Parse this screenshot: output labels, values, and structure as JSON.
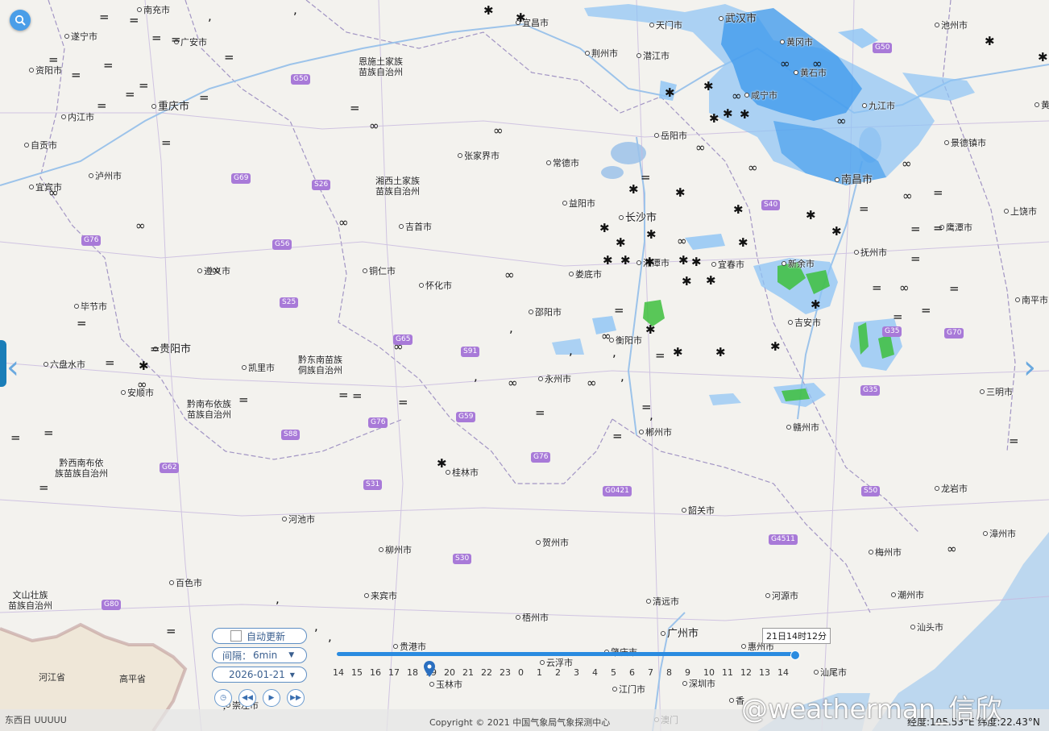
{
  "cities": [
    {
      "name": "南充市",
      "big": false
    },
    {
      "name": "遂宁市",
      "big": false
    },
    {
      "name": "广安市",
      "big": false
    },
    {
      "name": "资阳市",
      "big": false
    },
    {
      "name": "重庆市",
      "big": true
    },
    {
      "name": "内江市",
      "big": false
    },
    {
      "name": "自贡市",
      "big": false
    },
    {
      "name": "泸州市",
      "big": false
    },
    {
      "name": "宜宾市",
      "big": false
    },
    {
      "name": "毕节市",
      "big": false
    },
    {
      "name": "遵义市",
      "big": false
    },
    {
      "name": "六盘水市",
      "big": false
    },
    {
      "name": "贵阳市",
      "big": true
    },
    {
      "name": "安顺市",
      "big": false
    },
    {
      "name": "凯里市",
      "big": false
    },
    {
      "name": "恩施土家族苗族自治州",
      "big": false
    },
    {
      "name": "湘西土家族苗族自治州",
      "big": false
    },
    {
      "name": "张家界市",
      "big": false
    },
    {
      "name": "吉首市",
      "big": false
    },
    {
      "name": "铜仁市",
      "big": false
    },
    {
      "name": "怀化市",
      "big": false
    },
    {
      "name": "宜昌市",
      "big": false
    },
    {
      "name": "荆州市",
      "big": false
    },
    {
      "name": "天门市",
      "big": false
    },
    {
      "name": "潜江市",
      "big": false
    },
    {
      "name": "武汉市",
      "big": true
    },
    {
      "name": "黄冈市",
      "big": false
    },
    {
      "name": "黄石市",
      "big": false
    },
    {
      "name": "咸宁市",
      "big": false
    },
    {
      "name": "岳阳市",
      "big": false
    },
    {
      "name": "常德市",
      "big": false
    },
    {
      "name": "益阳市",
      "big": false
    },
    {
      "name": "长沙市",
      "big": true
    },
    {
      "name": "湘潭市",
      "big": false
    },
    {
      "name": "娄底市",
      "big": false
    },
    {
      "name": "邵阳市",
      "big": false
    },
    {
      "name": "衡阳市",
      "big": false
    },
    {
      "name": "永州市",
      "big": false
    },
    {
      "name": "郴州市",
      "big": false
    },
    {
      "name": "九江市",
      "big": false
    },
    {
      "name": "池州市",
      "big": false
    },
    {
      "name": "景德镇市",
      "big": false
    },
    {
      "name": "南昌市",
      "big": true
    },
    {
      "name": "上饶市",
      "big": false
    },
    {
      "name": "鹰潭市",
      "big": false
    },
    {
      "name": "抚州市",
      "big": false
    },
    {
      "name": "宜春市",
      "big": false
    },
    {
      "name": "新余市",
      "big": false
    },
    {
      "name": "吉安市",
      "big": false
    },
    {
      "name": "南平市",
      "big": false
    },
    {
      "name": "赣州市",
      "big": false
    },
    {
      "name": "三明市",
      "big": false
    },
    {
      "name": "龙岩市",
      "big": false
    },
    {
      "name": "桂林市",
      "big": false
    },
    {
      "name": "柳州市",
      "big": false
    },
    {
      "name": "河池市",
      "big": false
    },
    {
      "name": "贺州市",
      "big": false
    },
    {
      "name": "韶关市",
      "big": false
    },
    {
      "name": "百色市",
      "big": false
    },
    {
      "name": "来宾市",
      "big": false
    },
    {
      "name": "梧州市",
      "big": false
    },
    {
      "name": "贵港市",
      "big": false
    },
    {
      "name": "玉林市",
      "big": false
    },
    {
      "name": "云浮市",
      "big": false
    },
    {
      "name": "肇庆市",
      "big": false
    },
    {
      "name": "清远市",
      "big": false
    },
    {
      "name": "广州市",
      "big": true
    },
    {
      "name": "河源市",
      "big": false
    },
    {
      "name": "惠州市",
      "big": false
    },
    {
      "name": "梅州市",
      "big": false
    },
    {
      "name": "潮州市",
      "big": false
    },
    {
      "name": "汕头市",
      "big": false
    },
    {
      "name": "漳州市",
      "big": false
    },
    {
      "name": "汕尾市",
      "big": false
    },
    {
      "name": "江门市",
      "big": false
    },
    {
      "name": "深圳市",
      "big": false
    },
    {
      "name": "澳门",
      "big": false
    },
    {
      "name": "崇左市",
      "big": false
    },
    {
      "name": "黔东南苗族侗族自治州",
      "big": false
    },
    {
      "name": "黔南布依族苗族自治州",
      "big": false
    },
    {
      "name": "黔西南布依族苗族自治州",
      "big": false
    },
    {
      "name": "文山壮族苗族自治州",
      "big": false
    },
    {
      "name": "黄山",
      "big": false
    },
    {
      "name": "香",
      "big": false
    }
  ],
  "provinces": [
    "河江省",
    "高平省"
  ],
  "highways": [
    "G50",
    "G50",
    "G69",
    "S26",
    "G56",
    "G76",
    "S25",
    "G65",
    "S91",
    "G59",
    "G76",
    "S88",
    "G62",
    "S31",
    "G76",
    "G0421",
    "S30",
    "G80",
    "S40",
    "G35",
    "G70",
    "G35",
    "S50",
    "G4511",
    "G50"
  ],
  "controls": {
    "auto_update_label": "自动更新",
    "interval_label": "间隔：",
    "interval_value": "6min",
    "date_value": "2026-01-21",
    "time_tip": "21日14时12分",
    "timeline_ticks": [
      "14",
      "15",
      "16",
      "17",
      "18",
      "19",
      "20",
      "21",
      "22",
      "23",
      "0",
      "1",
      "2",
      "3",
      "4",
      "5",
      "6",
      "7",
      "8",
      "9",
      "10",
      "11",
      "12",
      "13",
      "14"
    ],
    "current_hour_fraction": 1.0
  },
  "footer": {
    "copyright": "Copyright © 2021 中国气象局气象探测中心",
    "coords": "经度:105.53°E 纬度:22.43°N",
    "watermark": "@weatherman_信欣",
    "bottom_left": "东西日 UUUUU"
  },
  "colors": {
    "radar_light": "#8cc3f5",
    "radar_mid": "#3a97ec",
    "radar_green": "#3dbf3d",
    "accent": "#2a8be0",
    "highway": "#a87ad8",
    "sea": "#bcd7ef"
  }
}
